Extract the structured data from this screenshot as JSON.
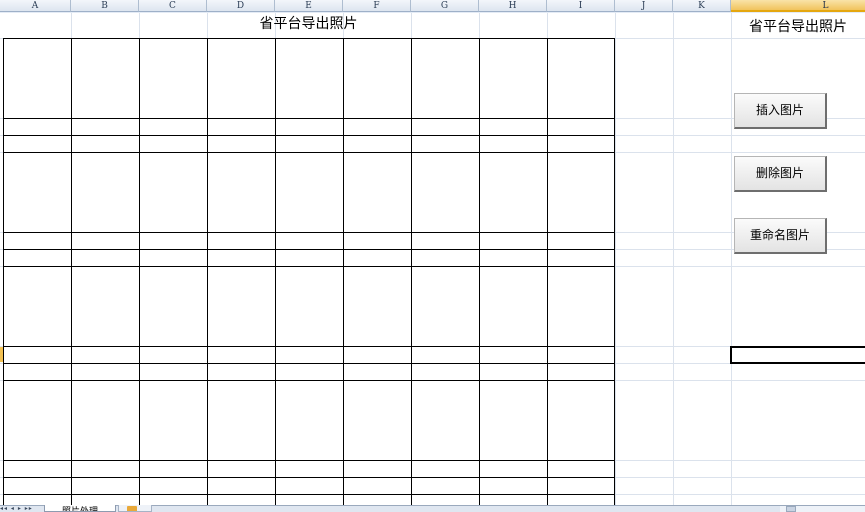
{
  "columns": [
    "A",
    "B",
    "C",
    "D",
    "E",
    "F",
    "G",
    "H",
    "I",
    "J",
    "K",
    "L"
  ],
  "selected_column": "L",
  "sheet_title": "省平台导出照片",
  "side_title": "省平台导出照片",
  "buttons": {
    "insert": "插入图片",
    "delete": "删除图片",
    "rename": "重命名图片"
  },
  "sheet_tabs": [
    {
      "label": "照片处理",
      "active": true
    }
  ],
  "colors": {
    "grid": "#dbe2ec",
    "header_bg": "#e4ebf5",
    "selected_header": "#f1c35c",
    "border": "#000000"
  }
}
